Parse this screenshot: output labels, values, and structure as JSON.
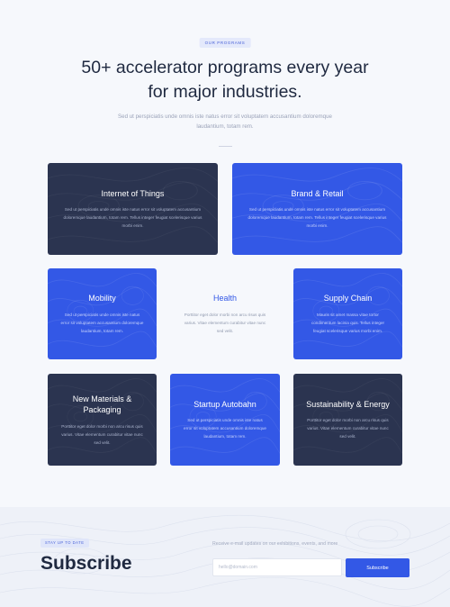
{
  "hero": {
    "badge": "OUR PROGRAMS",
    "title": "50+ accelerator programs every year for major industries.",
    "subtitle": "Sed ut perspiciatis unde omnis iste natus error sit voluptatem accusantium doloremque laudantium, totam rem."
  },
  "programs": [
    {
      "title": "Internet of Things",
      "desc": "Sed ut perspiciatis unde omnis iste natus error sit voluptatem accusantium doloremque laudantium, totam rem. Tellus integer feugiat scelerisque varius morbi enim.",
      "style": "dark"
    },
    {
      "title": "Brand & Retail",
      "desc": "Sed ut perspiciatis unde omnis iste natus error sit voluptatem accusantium doloremque laudantium, totam rem. Tellus integer feugiat scelerisque varius morbi enim.",
      "style": "blue"
    },
    {
      "title": "Mobility",
      "desc": "Sed ut perspiciatis unde omnis iste natus error sit voluptatem accusantium doloremque laudantium, totam rem.",
      "style": "blue"
    },
    {
      "title": "Health",
      "desc": "Porttitor eget dolor morbi non arcu risus quis varius. Vitae elementum curabitur vitae nunc sed velit.",
      "style": "plain"
    },
    {
      "title": "Supply Chain",
      "desc": "Mauris sit amet massa vitae tortor condimentum lacinia quis. Tellus integer feugiat scelerisque varius morbi enim.",
      "style": "blue"
    },
    {
      "title": "New Materials & Packaging",
      "desc": "Porttitor eget dolor morbi non arcu risus quis varius. Vitae elementum curabitur vitae nunc sed velit.",
      "style": "dark"
    },
    {
      "title": "Startup Autobahn",
      "desc": "Sed ut perspiciatis unde omnis iste natus error sit voluptatem accusantium doloremque laudantium, totam rem.",
      "style": "blue"
    },
    {
      "title": "Sustainability & Energy",
      "desc": "Porttitor eget dolor morbi non arcu risus quis varius. Vitae elementum curabitur vitae nunc sed velit.",
      "style": "dark"
    }
  ],
  "subscribe": {
    "badge": "STAY UP TO DATE",
    "title": "Subscribe",
    "note": "Receive e-mail updates on our exhibitions, events, and more",
    "input_placeholder": "hello@domain.com",
    "button": "Subscribe"
  },
  "colors": {
    "navy": "#2b3450",
    "blue": "#3358e6",
    "background": "#f6f8fc"
  }
}
